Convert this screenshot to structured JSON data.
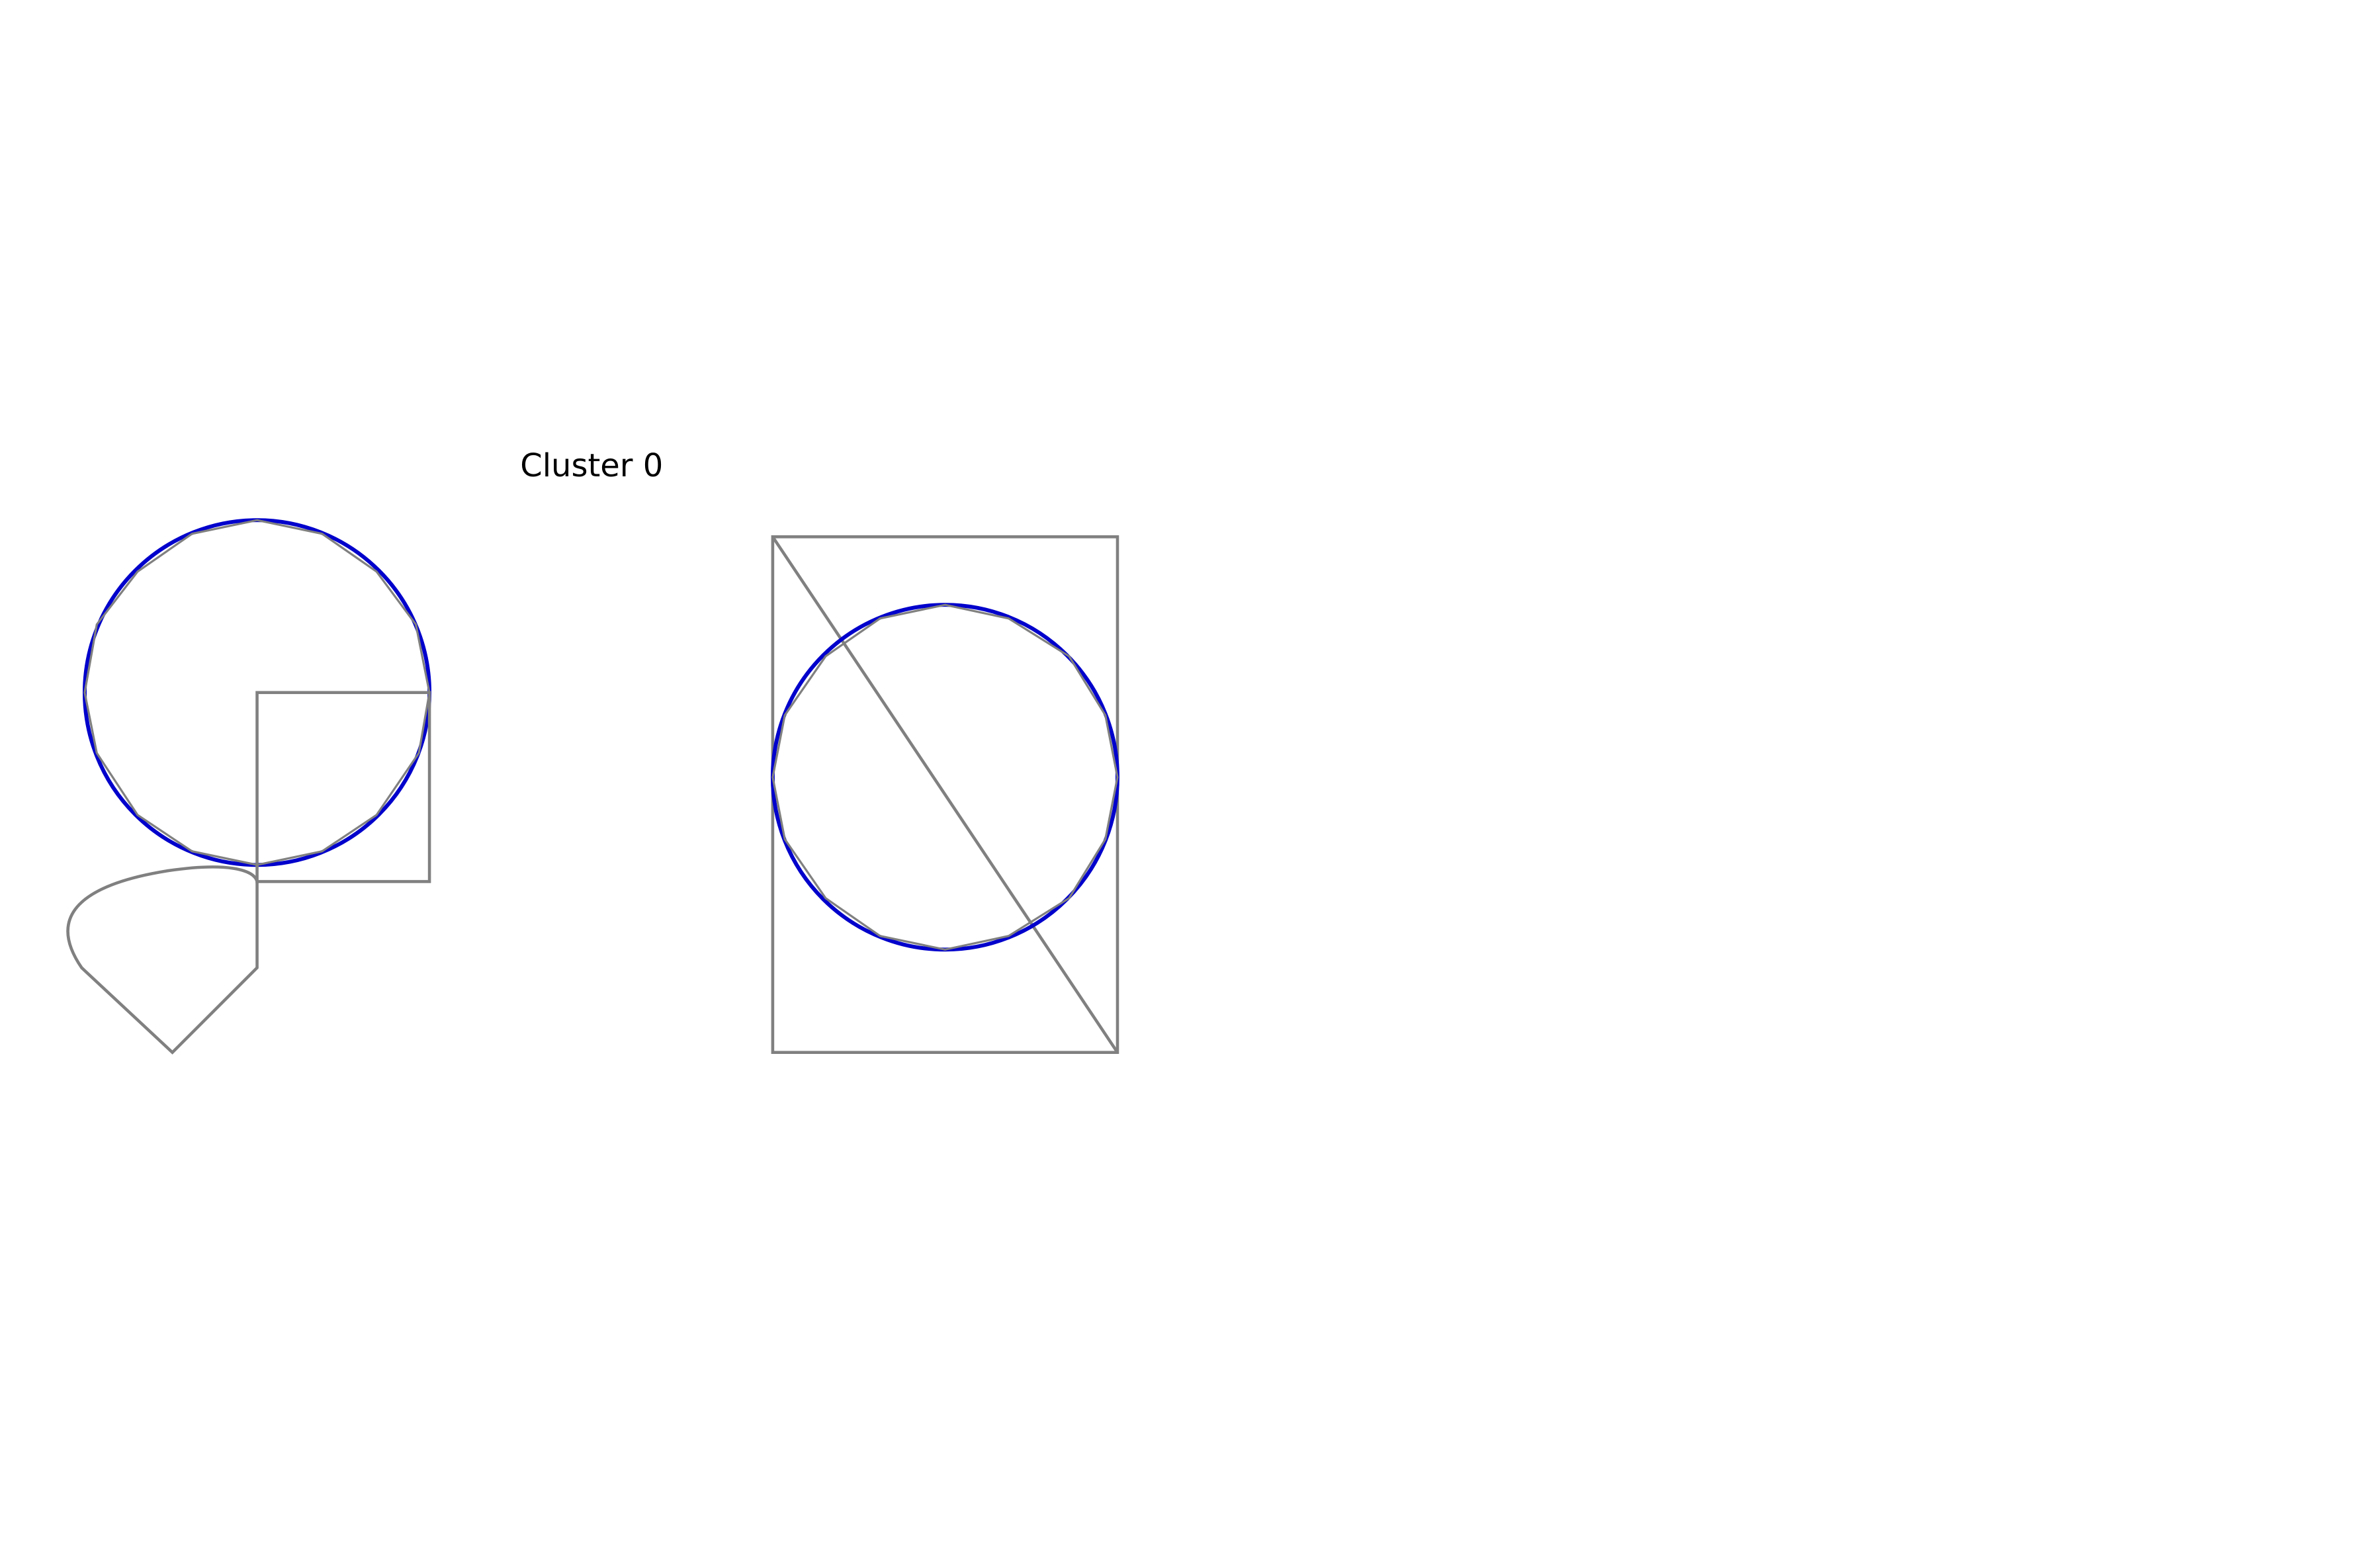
{
  "cluster": {
    "title": "Cluster 0"
  },
  "colors": {
    "background": "#ffffff",
    "sketch_stroke": "#808080",
    "circle_stroke": "#0000cc",
    "title_text": "#000000"
  },
  "sketches": [
    {
      "id": "sketch-1",
      "elements": [
        "circle",
        "polygon-approximation",
        "square",
        "teardrop-shape"
      ]
    },
    {
      "id": "sketch-2",
      "elements": [
        "circle",
        "polygon-approximation",
        "rectangle",
        "diagonal-line"
      ]
    }
  ]
}
